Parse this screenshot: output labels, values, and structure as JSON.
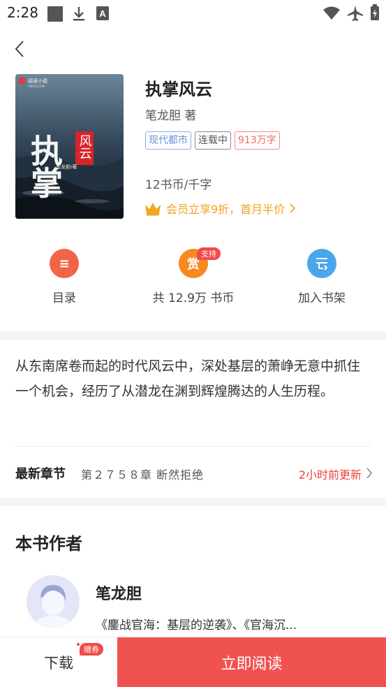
{
  "status_bar": {
    "time": "2:28"
  },
  "book": {
    "title": "执掌风云",
    "author": "笔龙胆 著",
    "tags": [
      "现代都市",
      "连载中",
      "913万字"
    ],
    "price": "12书币/千字",
    "vip_promo": "会员立享9折，首月半价",
    "cover": {
      "publisher": "阅读小说",
      "publisher_sub": "YREAD.COM",
      "calligraphy": "执掌",
      "seal": "风云",
      "author_sig": "笔龙胆/著"
    }
  },
  "actions": {
    "toc": {
      "icon_char": "≡",
      "label": "目录"
    },
    "reward": {
      "icon_char": "赏",
      "label": "共 12.9万 书币",
      "badge": "支持"
    },
    "shelf": {
      "label": "加入书架"
    }
  },
  "intro": "从东南席卷而起的时代风云中，深处基层的萧峥无意中抓住一个机会，经历了从潜龙在渊到辉煌腾达的人生历程。",
  "latest": {
    "label": "最新章节",
    "chapter": "第２７５８章 断然拒绝",
    "updated": "2小时前更新"
  },
  "author_section": {
    "heading": "本书作者",
    "name": "笔龙胆",
    "works": "《鏖战官海：基层的逆袭》、《官海沉..."
  },
  "bottom_bar": {
    "download": "下载",
    "coupon": "赠券",
    "read": "立即阅读"
  },
  "colors": {
    "accent_red": "#f0524f",
    "vip_gold": "#f0a21c",
    "tag_blue": "#6a8fdc"
  }
}
